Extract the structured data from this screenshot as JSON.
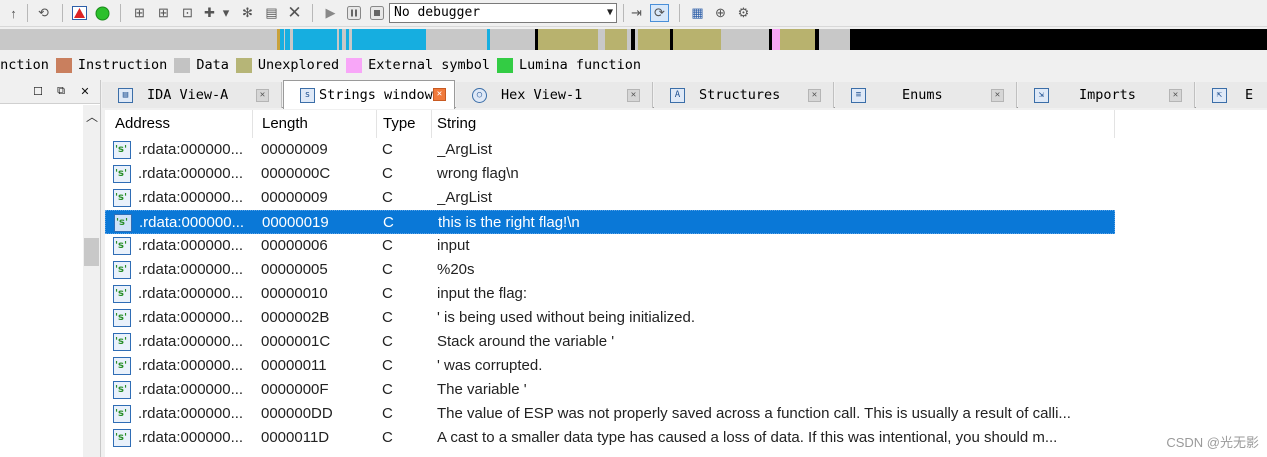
{
  "toolbar": {
    "debugger_select": "No debugger",
    "icons": [
      "back-icon",
      "search-back-icon",
      "breakpoint-icon",
      "run-green-icon",
      "code-icon",
      "data-icon",
      "struct-icon",
      "add-icon",
      "dropdown-icon",
      "gear-icon",
      "image-icon",
      "close-icon",
      "play-icon",
      "pause-icon",
      "stop-icon",
      "step-icon",
      "attach-icon",
      "graph-icon",
      "pin-icon",
      "tool-icon"
    ]
  },
  "nav_band_colors": {
    "function": "#16aee0",
    "library": "#b8b26e",
    "unexplored": "#c8c8c8",
    "external": "#f7a6f4",
    "black": "#000000",
    "gold": "#c9a13b"
  },
  "legend": {
    "items": [
      {
        "label": "unction",
        "color": ""
      },
      {
        "label": "Instruction",
        "color": "#c97f5e"
      },
      {
        "label": "Data",
        "color": "#c3c3c3"
      },
      {
        "label": "Unexplored",
        "color": "#b6b577"
      },
      {
        "label": "External symbol",
        "color": "#f8a6f8"
      },
      {
        "label": "Lumina function",
        "color": "#33cc44"
      }
    ]
  },
  "tabs": [
    {
      "label": "IDA View-A",
      "icon": "ida-view-icon",
      "active": false
    },
    {
      "label": "Strings window",
      "icon": "strings-window-icon",
      "active": true
    },
    {
      "label": "Hex View-1",
      "icon": "hex-view-icon",
      "active": false
    },
    {
      "label": "Structures",
      "icon": "structures-icon",
      "active": false
    },
    {
      "label": "Enums",
      "icon": "enums-icon",
      "active": false
    },
    {
      "label": "Imports",
      "icon": "imports-icon",
      "active": false
    },
    {
      "label": "E",
      "icon": "exports-icon",
      "active": false
    }
  ],
  "grid": {
    "columns": [
      "Address",
      "Length",
      "Type",
      "String"
    ],
    "rows": [
      {
        "address": ".rdata:000000...",
        "length": "00000009",
        "type": "C",
        "string": "_ArgList"
      },
      {
        "address": ".rdata:000000...",
        "length": "0000000C",
        "type": "C",
        "string": "wrong flag\\n"
      },
      {
        "address": ".rdata:000000...",
        "length": "00000009",
        "type": "C",
        "string": "_ArgList"
      },
      {
        "address": ".rdata:000000...",
        "length": "00000019",
        "type": "C",
        "string": "this is the right flag!\\n",
        "selected": true
      },
      {
        "address": ".rdata:000000...",
        "length": "00000006",
        "type": "C",
        "string": "input"
      },
      {
        "address": ".rdata:000000...",
        "length": "00000005",
        "type": "C",
        "string": "%20s"
      },
      {
        "address": ".rdata:000000...",
        "length": "00000010",
        "type": "C",
        "string": "input the flag:"
      },
      {
        "address": ".rdata:000000...",
        "length": "0000002B",
        "type": "C",
        "string": "' is being used without being initialized."
      },
      {
        "address": ".rdata:000000...",
        "length": "0000001C",
        "type": "C",
        "string": "Stack around the variable '"
      },
      {
        "address": ".rdata:000000...",
        "length": "00000011",
        "type": "C",
        "string": "' was corrupted."
      },
      {
        "address": ".rdata:000000...",
        "length": "0000000F",
        "type": "C",
        "string": "The variable '"
      },
      {
        "address": ".rdata:000000...",
        "length": "000000DD",
        "type": "C",
        "string": "The value of ESP was not properly saved across a function call.  This is usually a result of calli..."
      },
      {
        "address": ".rdata:000000...",
        "length": "0000011D",
        "type": "C",
        "string": "A cast to a smaller data type has caused a loss of data.  If this was intentional, you should m..."
      }
    ]
  },
  "watermark": "CSDN @光无影"
}
